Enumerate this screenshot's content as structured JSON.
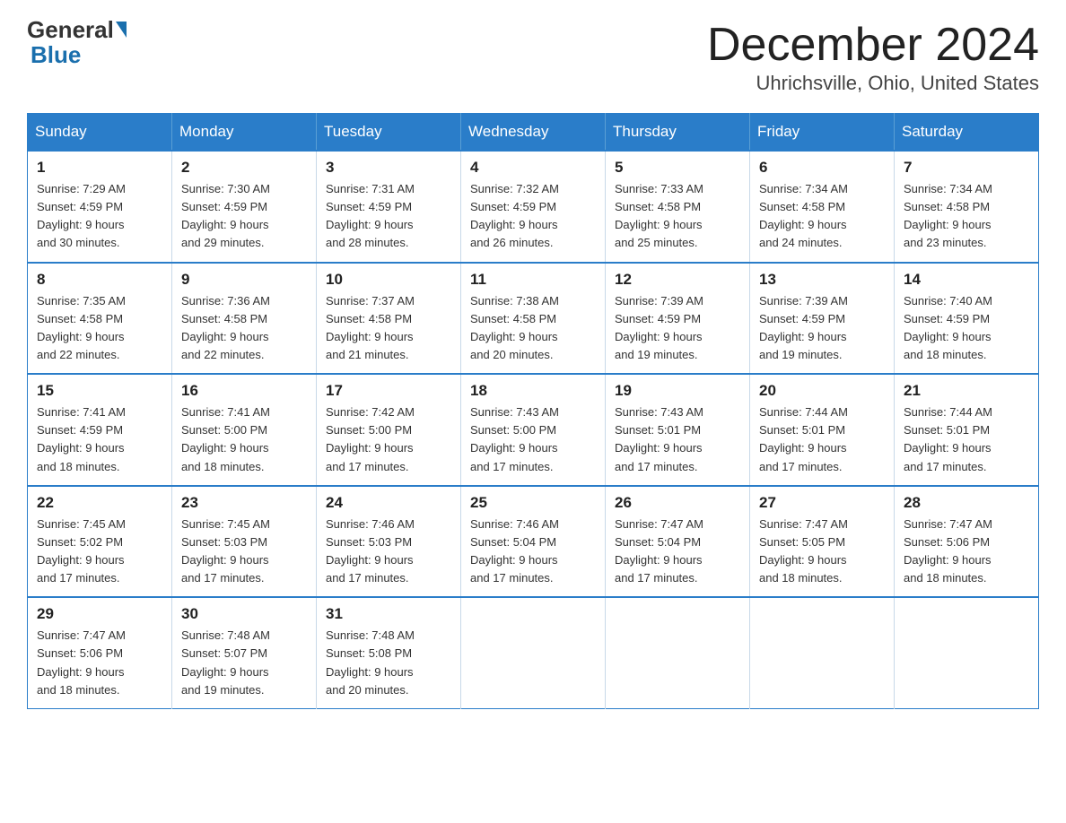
{
  "header": {
    "logo": {
      "general": "General",
      "blue": "Blue"
    },
    "title": "December 2024",
    "location": "Uhrichsville, Ohio, United States"
  },
  "weekdays": [
    "Sunday",
    "Monday",
    "Tuesday",
    "Wednesday",
    "Thursday",
    "Friday",
    "Saturday"
  ],
  "weeks": [
    [
      {
        "day": "1",
        "sunrise": "7:29 AM",
        "sunset": "4:59 PM",
        "daylight": "9 hours and 30 minutes."
      },
      {
        "day": "2",
        "sunrise": "7:30 AM",
        "sunset": "4:59 PM",
        "daylight": "9 hours and 29 minutes."
      },
      {
        "day": "3",
        "sunrise": "7:31 AM",
        "sunset": "4:59 PM",
        "daylight": "9 hours and 28 minutes."
      },
      {
        "day": "4",
        "sunrise": "7:32 AM",
        "sunset": "4:59 PM",
        "daylight": "9 hours and 26 minutes."
      },
      {
        "day": "5",
        "sunrise": "7:33 AM",
        "sunset": "4:58 PM",
        "daylight": "9 hours and 25 minutes."
      },
      {
        "day": "6",
        "sunrise": "7:34 AM",
        "sunset": "4:58 PM",
        "daylight": "9 hours and 24 minutes."
      },
      {
        "day": "7",
        "sunrise": "7:34 AM",
        "sunset": "4:58 PM",
        "daylight": "9 hours and 23 minutes."
      }
    ],
    [
      {
        "day": "8",
        "sunrise": "7:35 AM",
        "sunset": "4:58 PM",
        "daylight": "9 hours and 22 minutes."
      },
      {
        "day": "9",
        "sunrise": "7:36 AM",
        "sunset": "4:58 PM",
        "daylight": "9 hours and 22 minutes."
      },
      {
        "day": "10",
        "sunrise": "7:37 AM",
        "sunset": "4:58 PM",
        "daylight": "9 hours and 21 minutes."
      },
      {
        "day": "11",
        "sunrise": "7:38 AM",
        "sunset": "4:58 PM",
        "daylight": "9 hours and 20 minutes."
      },
      {
        "day": "12",
        "sunrise": "7:39 AM",
        "sunset": "4:59 PM",
        "daylight": "9 hours and 19 minutes."
      },
      {
        "day": "13",
        "sunrise": "7:39 AM",
        "sunset": "4:59 PM",
        "daylight": "9 hours and 19 minutes."
      },
      {
        "day": "14",
        "sunrise": "7:40 AM",
        "sunset": "4:59 PM",
        "daylight": "9 hours and 18 minutes."
      }
    ],
    [
      {
        "day": "15",
        "sunrise": "7:41 AM",
        "sunset": "4:59 PM",
        "daylight": "9 hours and 18 minutes."
      },
      {
        "day": "16",
        "sunrise": "7:41 AM",
        "sunset": "5:00 PM",
        "daylight": "9 hours and 18 minutes."
      },
      {
        "day": "17",
        "sunrise": "7:42 AM",
        "sunset": "5:00 PM",
        "daylight": "9 hours and 17 minutes."
      },
      {
        "day": "18",
        "sunrise": "7:43 AM",
        "sunset": "5:00 PM",
        "daylight": "9 hours and 17 minutes."
      },
      {
        "day": "19",
        "sunrise": "7:43 AM",
        "sunset": "5:01 PM",
        "daylight": "9 hours and 17 minutes."
      },
      {
        "day": "20",
        "sunrise": "7:44 AM",
        "sunset": "5:01 PM",
        "daylight": "9 hours and 17 minutes."
      },
      {
        "day": "21",
        "sunrise": "7:44 AM",
        "sunset": "5:01 PM",
        "daylight": "9 hours and 17 minutes."
      }
    ],
    [
      {
        "day": "22",
        "sunrise": "7:45 AM",
        "sunset": "5:02 PM",
        "daylight": "9 hours and 17 minutes."
      },
      {
        "day": "23",
        "sunrise": "7:45 AM",
        "sunset": "5:03 PM",
        "daylight": "9 hours and 17 minutes."
      },
      {
        "day": "24",
        "sunrise": "7:46 AM",
        "sunset": "5:03 PM",
        "daylight": "9 hours and 17 minutes."
      },
      {
        "day": "25",
        "sunrise": "7:46 AM",
        "sunset": "5:04 PM",
        "daylight": "9 hours and 17 minutes."
      },
      {
        "day": "26",
        "sunrise": "7:47 AM",
        "sunset": "5:04 PM",
        "daylight": "9 hours and 17 minutes."
      },
      {
        "day": "27",
        "sunrise": "7:47 AM",
        "sunset": "5:05 PM",
        "daylight": "9 hours and 18 minutes."
      },
      {
        "day": "28",
        "sunrise": "7:47 AM",
        "sunset": "5:06 PM",
        "daylight": "9 hours and 18 minutes."
      }
    ],
    [
      {
        "day": "29",
        "sunrise": "7:47 AM",
        "sunset": "5:06 PM",
        "daylight": "9 hours and 18 minutes."
      },
      {
        "day": "30",
        "sunrise": "7:48 AM",
        "sunset": "5:07 PM",
        "daylight": "9 hours and 19 minutes."
      },
      {
        "day": "31",
        "sunrise": "7:48 AM",
        "sunset": "5:08 PM",
        "daylight": "9 hours and 20 minutes."
      },
      null,
      null,
      null,
      null
    ]
  ],
  "labels": {
    "sunrise": "Sunrise:",
    "sunset": "Sunset:",
    "daylight": "Daylight:"
  }
}
